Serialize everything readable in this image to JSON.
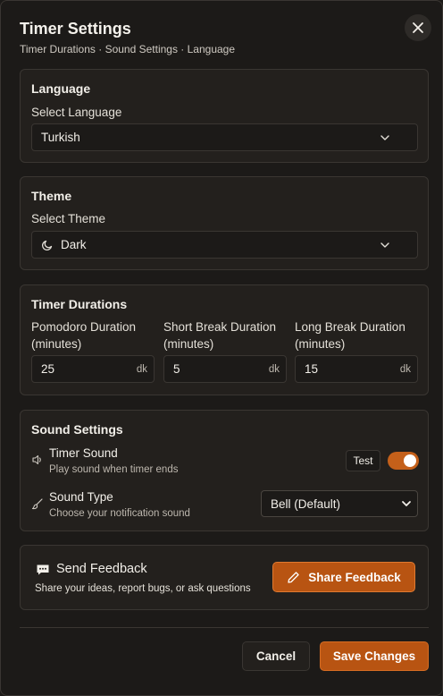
{
  "header": {
    "title": "Timer Settings",
    "breadcrumb": "Timer Durations · Sound Settings · Language",
    "close_icon": "close-icon"
  },
  "language": {
    "title": "Language",
    "select_label": "Select Language",
    "selected": "Turkish"
  },
  "theme": {
    "title": "Theme",
    "select_label": "Select Theme",
    "selected": "Dark",
    "selected_icon": "moon-icon"
  },
  "durations": {
    "title": "Timer Durations",
    "fields": [
      {
        "label_line1": "Pomodoro Duration",
        "label_line2": "(minutes)",
        "value": "25",
        "unit": "dk"
      },
      {
        "label_line1": "Short Break Duration",
        "label_line2": "(minutes)",
        "value": "5",
        "unit": "dk"
      },
      {
        "label_line1": "Long Break Duration",
        "label_line2": "(minutes)",
        "value": "15",
        "unit": "dk"
      }
    ]
  },
  "sound": {
    "title": "Sound Settings",
    "timer_sound_title": "Timer Sound",
    "timer_sound_desc": "Play sound when timer ends",
    "test_label": "Test",
    "timer_sound_enabled": true,
    "sound_type_title": "Sound Type",
    "sound_type_desc": "Choose your notification sound",
    "sound_type_selected": "Bell (Default)"
  },
  "feedback": {
    "title": "Send Feedback",
    "desc": "Share your ideas, report bugs, or ask questions",
    "button_label": "Share Feedback"
  },
  "footer": {
    "cancel_label": "Cancel",
    "save_label": "Save Changes"
  },
  "colors": {
    "background": "#1c1a18",
    "card": "#23201d",
    "accent": "#b85412",
    "toggle_on": "#c4601a"
  }
}
